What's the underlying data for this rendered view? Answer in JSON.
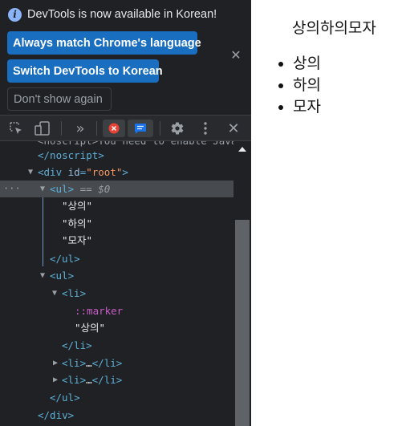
{
  "banner": {
    "message": "DevTools is now available in Korean!",
    "info_icon": "i",
    "match_button": "Always match Chrome's language",
    "switch_button": "Switch DevTools to Korean",
    "dismiss_button": "Don't show again",
    "close_icon": "✕"
  },
  "toolbar": {
    "icons": [
      "inspect-element-icon",
      "device-toolbar-icon",
      "more-tabs-icon",
      "error-icon",
      "issues-icon",
      "settings-icon",
      "more-options-icon",
      "close-icon"
    ],
    "more_tabs_glyph": "»",
    "close_glyph": "✕",
    "error_color": "#e94235",
    "issues_color": "#1a73e8"
  },
  "elements": {
    "partial_line": "<noscript>You need to enable JavaScript to run this app.",
    "lines": {
      "noscript_close": "</noscript>",
      "div_open_tag": "<div",
      "div_attr_name": "id",
      "div_attr_value": "\"root\"",
      "div_open_end": ">",
      "ul1_open": "<ul>",
      "ul1_eq": " == ",
      "ul1_var": "$0",
      "ul1_text1": "\"상의\"",
      "ul1_text2": "\"하의\"",
      "ul1_text3": "\"모자\"",
      "ul1_close": "</ul>",
      "ul2_open": "<ul>",
      "li_open": "<li>",
      "marker": "::marker",
      "li_text": "\"상의\"",
      "li_close": "</li>",
      "li_collapsed_1_open": "<li>",
      "li_collapsed_1_ellipsis": "…",
      "li_collapsed_1_close": "</li>",
      "li_collapsed_2_open": "<li>",
      "li_collapsed_2_ellipsis": "…",
      "li_collapsed_2_close": "</li>",
      "ul2_close": "</ul>",
      "div_close": "</div>"
    },
    "dots": "···"
  },
  "page": {
    "text": "상의하의모자",
    "list": [
      "상의",
      "하의",
      "모자"
    ]
  }
}
